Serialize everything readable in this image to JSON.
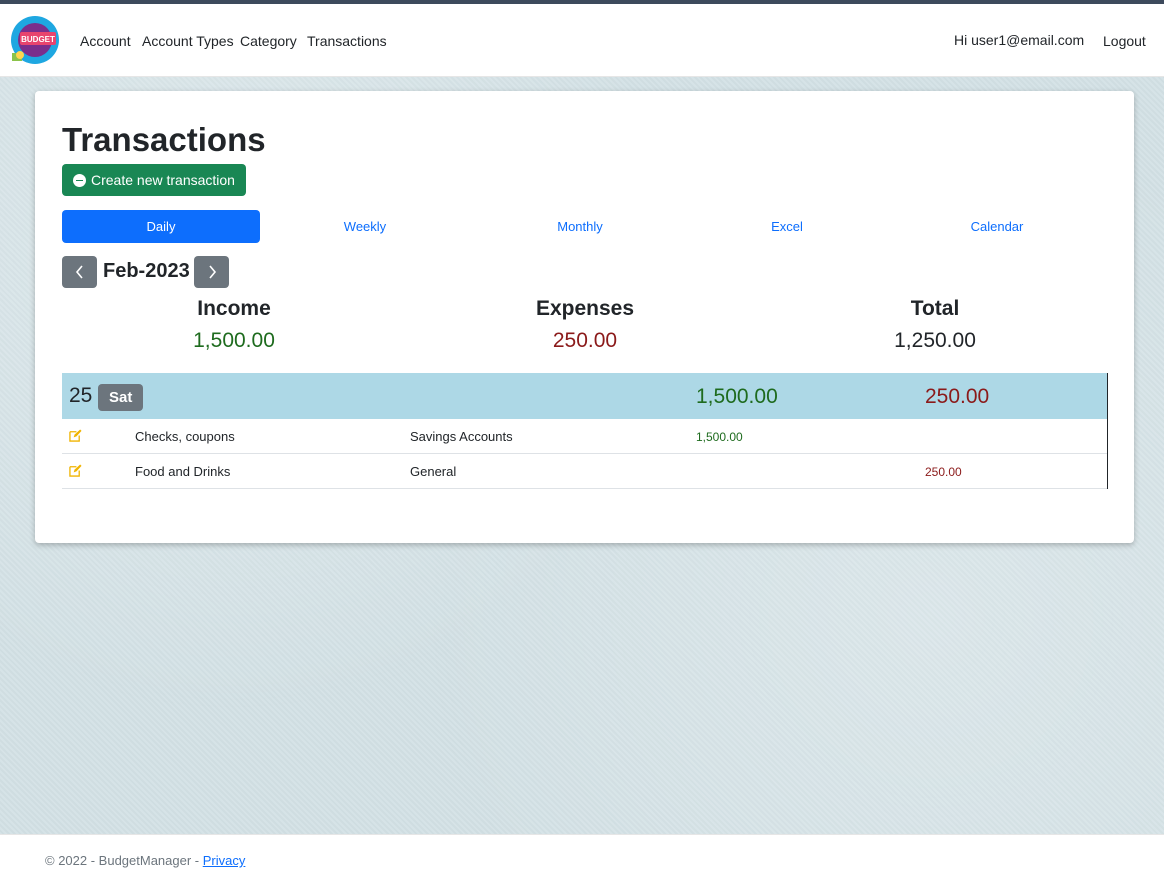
{
  "nav": {
    "logo_text": "BUDGET",
    "links": [
      "Account",
      "Account Types",
      "Category",
      "Transactions"
    ],
    "greeting": "Hi user1@email.com",
    "logout": "Logout"
  },
  "page": {
    "title": "Transactions",
    "create_button": "Create new transaction"
  },
  "tabs": [
    {
      "label": "Daily",
      "active": true
    },
    {
      "label": "Weekly",
      "active": false
    },
    {
      "label": "Monthly",
      "active": false
    },
    {
      "label": "Excel",
      "active": false
    },
    {
      "label": "Calendar",
      "active": false
    }
  ],
  "month": {
    "prev_icon": "chevron-left-icon",
    "label": "Feb-2023",
    "next_icon": "chevron-right-icon"
  },
  "summary": {
    "income_label": "Income",
    "income_value": "1,500.00",
    "expenses_label": "Expenses",
    "expenses_value": "250.00",
    "total_label": "Total",
    "total_value": "1,250.00"
  },
  "days": [
    {
      "day": "25",
      "weekday": "Sat",
      "income": "1,500.00",
      "expense": "250.00",
      "transactions": [
        {
          "category": "Checks, coupons",
          "account": "Savings Accounts",
          "income": "1,500.00",
          "expense": ""
        },
        {
          "category": "Food and Drinks",
          "account": "General",
          "income": "",
          "expense": "250.00"
        }
      ]
    }
  ],
  "footer": {
    "text": "© 2022 - BudgetManager - ",
    "privacy": "Privacy"
  },
  "colors": {
    "primary": "#0d6efd",
    "success": "#198754",
    "income": "#1e6b1e",
    "expense": "#8b1a1a",
    "day_row": "#add8e6",
    "secondary": "#6c757d"
  }
}
